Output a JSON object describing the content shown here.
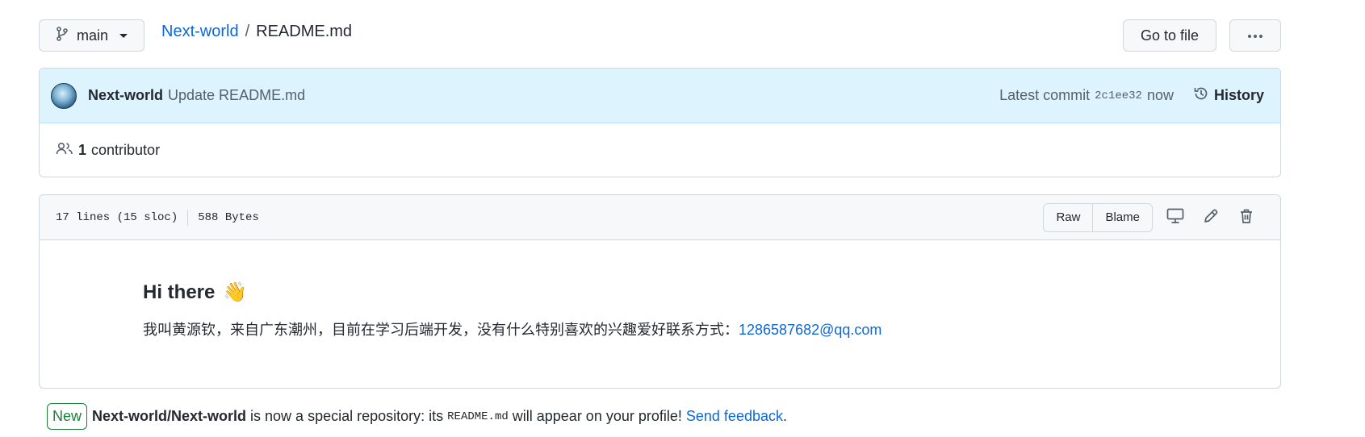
{
  "branch": {
    "name": "main",
    "icon": "git-branch-icon"
  },
  "breadcrumb": {
    "repo": "Next-world",
    "separator": "/",
    "file": "README.md"
  },
  "toolbar": {
    "goto_file": "Go to file",
    "more": "more-options-icon"
  },
  "commit": {
    "author": "Next-world",
    "message": "Update README.md",
    "latest_label": "Latest commit",
    "sha": "2c1ee32",
    "time": "now",
    "history_label": "History"
  },
  "contributors": {
    "count": "1",
    "label": "contributor"
  },
  "file": {
    "lines": "17 lines (15 sloc)",
    "size": "588 Bytes",
    "raw_label": "Raw",
    "blame_label": "Blame"
  },
  "readme": {
    "heading": "Hi there",
    "heading_emoji": "👋",
    "paragraph": "我叫黄源钦，来自广东潮州，目前在学习后端开发，没有什么特别喜欢的兴趣爱好联系方式：",
    "email": "1286587682@qq.com"
  },
  "notice": {
    "badge": "New",
    "repo": "Next-world/Next-world",
    "text1": "is now a special repository: its",
    "code": "README.md",
    "text2": "will appear on your profile!",
    "feedback": "Send feedback",
    "end": "."
  },
  "colors": {
    "accent": "#0969da",
    "commit_bg": "#ddf4ff",
    "new_badge": "#1a7f37"
  }
}
